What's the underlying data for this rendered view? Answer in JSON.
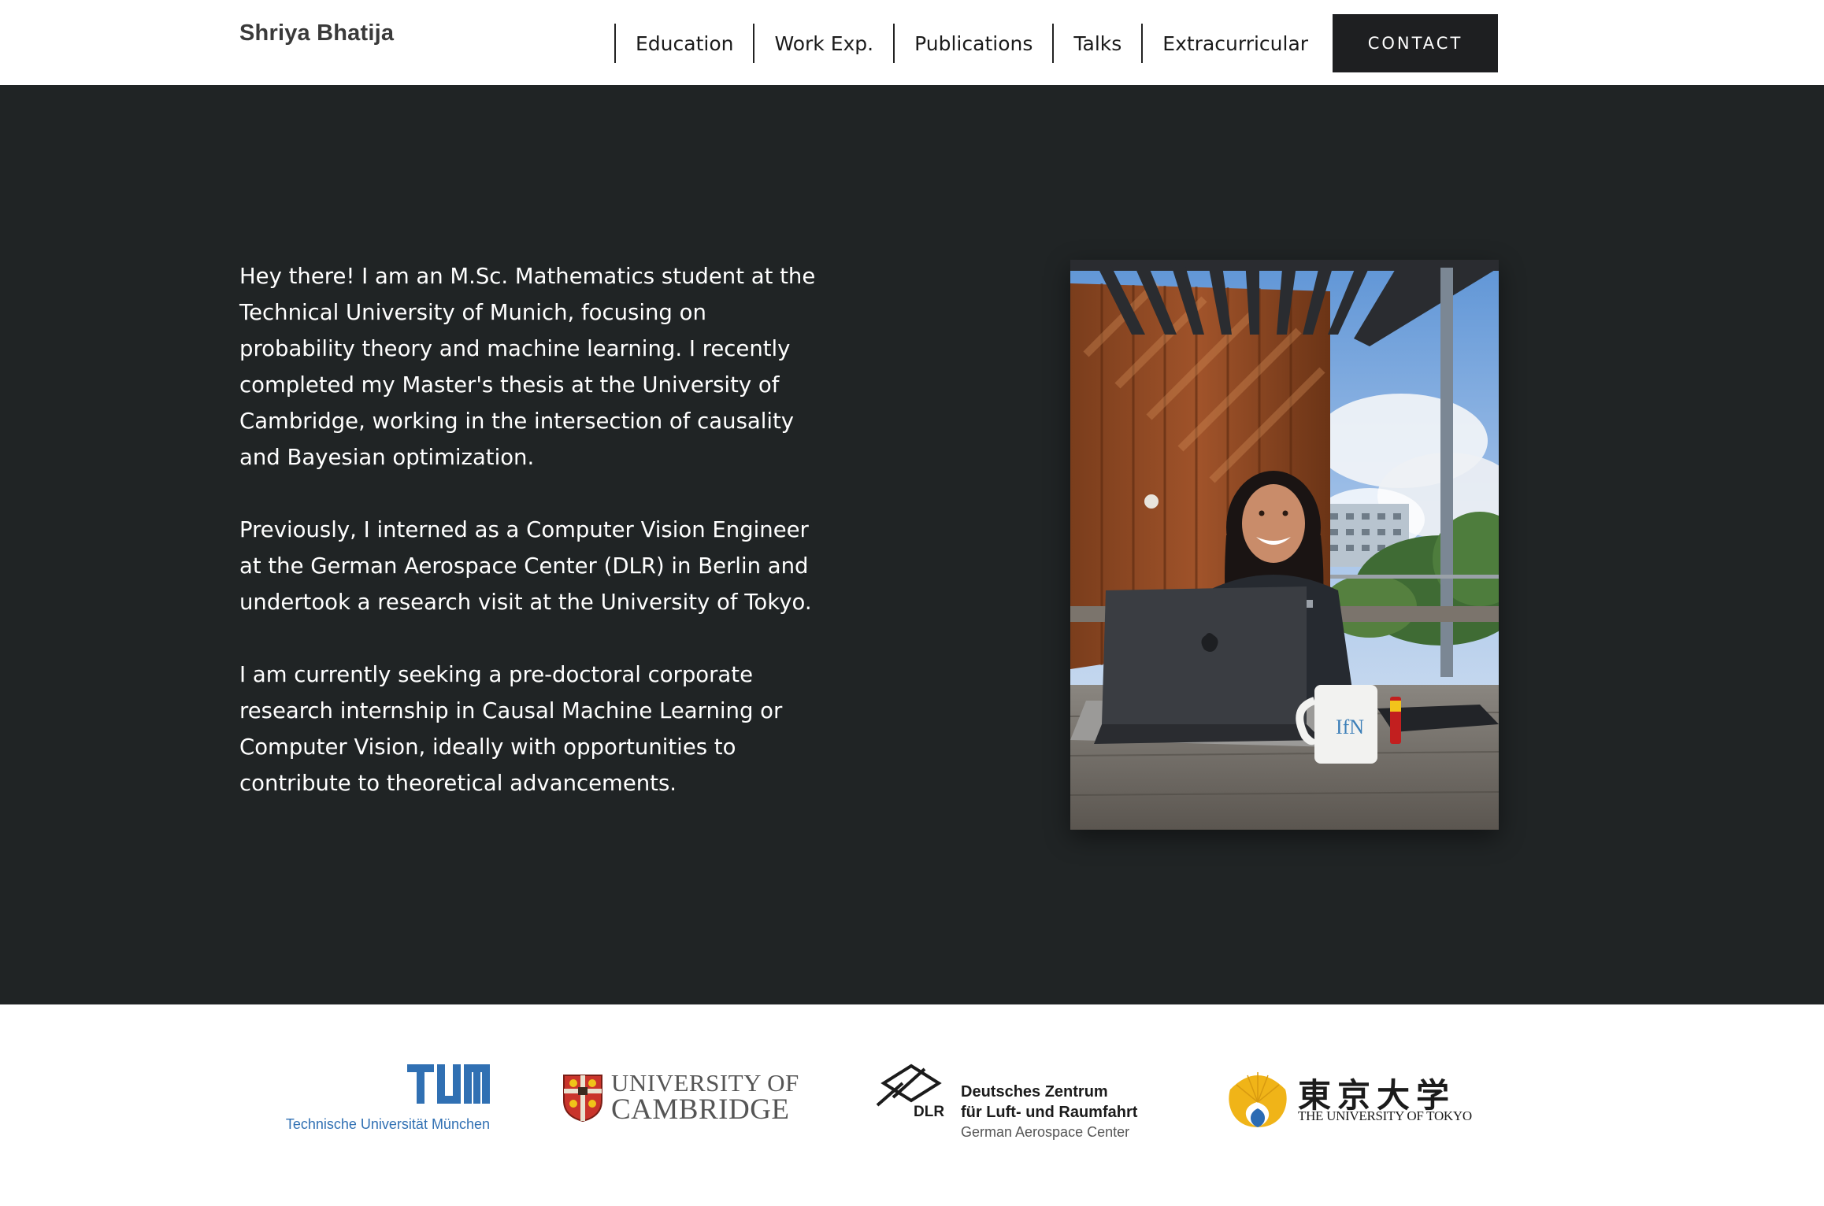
{
  "header": {
    "brand": "Shriya Bhatija",
    "nav": [
      "Education",
      "Work Exp.",
      "Publications",
      "Talks",
      "Extracurricular"
    ],
    "contact_label": "CONTACT"
  },
  "hero": {
    "paragraphs": [
      "Hey there! I am an M.Sc. Mathematics student at the Technical University of Munich, focusing on probability theory and machine learning. I recently completed my Master's thesis at the University of Cambridge, working in the intersection of causality and Bayesian optimization.",
      "Previously, I interned as a Computer Vision Engineer at the German Aerospace Center (DLR) in Berlin and undertook a research visit at the University of Tokyo.",
      "I am currently seeking a pre-doctoral corporate research internship in Causal Machine Learning or Computer Vision, ideally with opportunities to contribute to theoretical advancements."
    ],
    "mug_text": "IfN"
  },
  "logos": {
    "tum": {
      "wordmark": "TUM",
      "caption": "Technische Universität München",
      "color": "#3070b3"
    },
    "cambridge": {
      "line1": "UNIVERSITY OF",
      "line2": "CAMBRIDGE"
    },
    "dlr": {
      "abbr": "DLR",
      "line1": "Deutsches Zentrum",
      "line2": "für Luft- und Raumfahrt",
      "line3": "German Aerospace Center"
    },
    "tokyo": {
      "kanji": "東京大学",
      "english": "THE UNIVERSITY OF TOKYO"
    }
  },
  "colors": {
    "hero_bg": "#202425",
    "contact_bg": "#1e1f21",
    "tum_blue": "#3070b3",
    "tokyo_gold": "#f0b418"
  }
}
